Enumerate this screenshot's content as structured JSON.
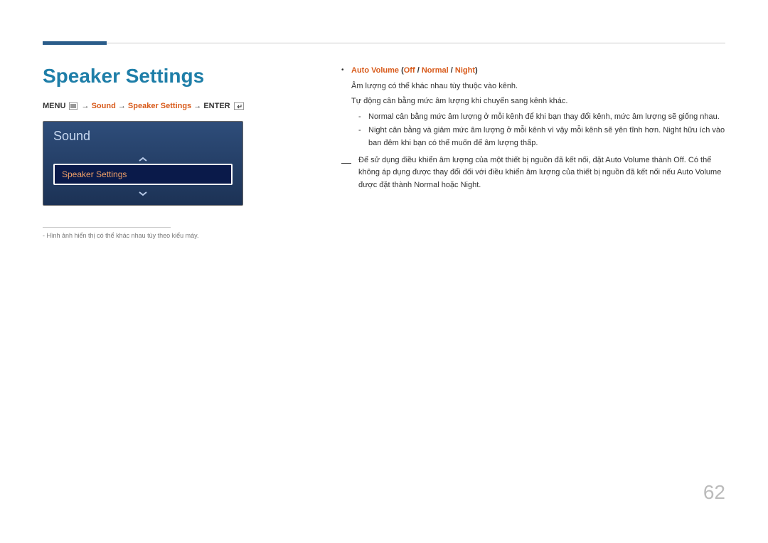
{
  "page": {
    "title": "Speaker Settings",
    "page_number": "62"
  },
  "breadcrumb": {
    "menu": "MENU",
    "arrow": "→",
    "sound": "Sound",
    "speaker_settings": "Speaker Settings",
    "enter": "ENTER"
  },
  "osd": {
    "title": "Sound",
    "selected_item": "Speaker Settings"
  },
  "footnote": {
    "dash": "-",
    "text": "Hình ảnh hiển thị có thể khác nhau tùy theo kiểu máy."
  },
  "content": {
    "bullet_mark": "•",
    "auto_volume_label": "Auto Volume",
    "open_paren": " (",
    "off": "Off",
    "slash": " / ",
    "normal": "Normal",
    "night": "Night",
    "close_paren": ")",
    "line1": "Âm lượng có thể khác nhau tùy thuộc vào kênh.",
    "line2": "Tự động cân bằng mức âm lượng khi chuyển sang kênh khác.",
    "dash": "-",
    "normal_desc": " cân bằng mức âm lượng ở mỗi kênh để khi bạn thay đổi kênh, mức âm lượng sẽ giống nhau.",
    "night_desc1": " cân bằng và giảm mức âm lượng ở mỗi kênh vì vậy mỗi kênh sẽ yên tĩnh hơn. ",
    "night_desc2": " hữu ích vào ban đêm khi bạn có thể muốn để âm lượng thấp.",
    "note_mark": "―",
    "note_pre": "Để sử dụng điều khiển âm lượng của một thiết bị nguồn đã kết nối, đặt ",
    "note_av": "Auto Volume",
    "note_to": " thành ",
    "note_off": "Off",
    "note_post1": ". Có thể không áp dụng được thay đổi đối với điều khiển âm lượng của thiết bị nguồn đã kết nối nếu ",
    "note_set_to": " được đặt thành ",
    "note_or": " hoặc ",
    "note_period": "."
  }
}
